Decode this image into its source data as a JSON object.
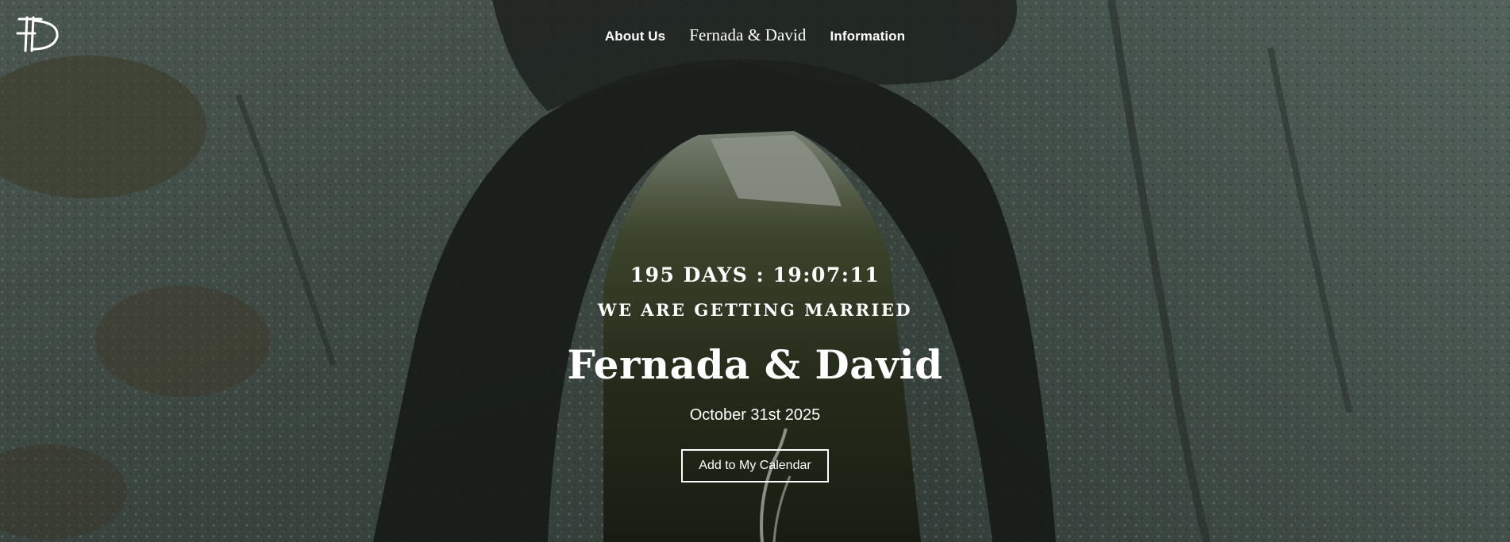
{
  "header": {
    "logo_icon": "fd-monogram-logo",
    "nav": {
      "about_label": "About Us",
      "brand_label": "Fernada & David",
      "information_label": "Information"
    }
  },
  "hero": {
    "background": "rocky-arch-forest-photo",
    "countdown": "195 DAYS : 19:07:11",
    "tagline": "WE ARE GETTING MARRIED",
    "names": "Fernada & David",
    "date": "October 31st 2025",
    "calendar_button_label": "Add to My Calendar"
  },
  "colors": {
    "text": "#ffffff",
    "button_border": "#ffffff"
  }
}
